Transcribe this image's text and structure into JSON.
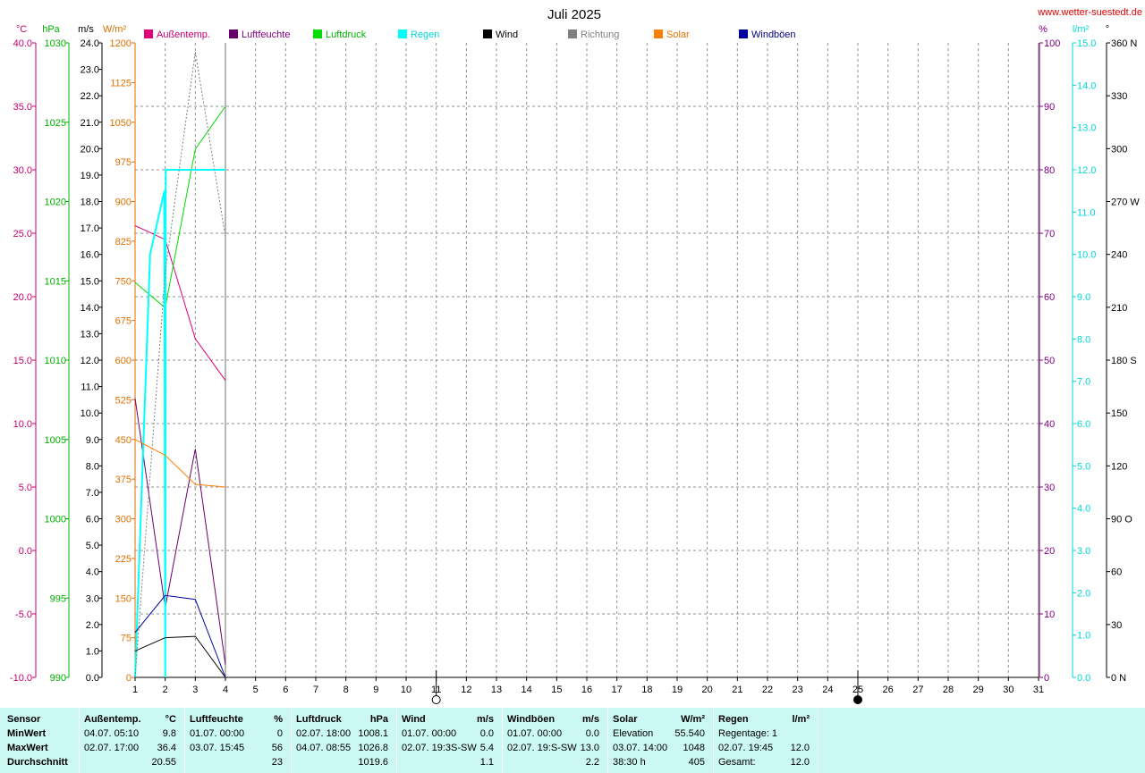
{
  "title": "Juli 2025",
  "site": "www.wetter-suestedt.de",
  "legend": [
    {
      "label": "Außentemp.",
      "color": "#e0007a",
      "text_color": "#c8006e"
    },
    {
      "label": "Luftfeuchte",
      "color": "#6a006a",
      "text_color": "#800080"
    },
    {
      "label": "Luftdruck",
      "color": "#00dd00",
      "text_color": "#00b000"
    },
    {
      "label": "Regen",
      "color": "#00ffff",
      "text_color": "#00d8d8"
    },
    {
      "label": "Wind",
      "color": "#000000",
      "text_color": "#000000"
    },
    {
      "label": "Richtung",
      "color": "#808080",
      "text_color": "#808080"
    },
    {
      "label": "Solar",
      "color": "#ff8000",
      "text_color": "#e07000"
    },
    {
      "label": "Windböen",
      "color": "#0000a0",
      "text_color": "#000080"
    }
  ],
  "chart_data": {
    "type": "line",
    "title": "Juli 2025",
    "x": [
      1,
      2,
      3,
      4
    ],
    "xlim": [
      1,
      31
    ],
    "xticks": [
      "1",
      "2",
      "3",
      "4",
      "5",
      "6",
      "7",
      "8",
      "9",
      "10",
      "11",
      "12",
      "13",
      "14",
      "15",
      "16",
      "17",
      "18",
      "19",
      "20",
      "21",
      "22",
      "23",
      "24",
      "25",
      "26",
      "27",
      "28",
      "29",
      "30",
      "31"
    ],
    "axes": {
      "temp": {
        "unit": "°C",
        "ticks": [
          "40.0",
          "35.0",
          "30.0",
          "25.0",
          "20.0",
          "15.0",
          "10.0",
          "5.0",
          "0.0",
          "-5.0",
          "-10.0"
        ],
        "range": [
          -10,
          40
        ],
        "color": "#c8006e"
      },
      "pressure": {
        "unit": "hPa",
        "ticks": [
          "1030",
          "1025",
          "1020",
          "1015",
          "1010",
          "1005",
          "1000",
          "995",
          "990"
        ],
        "range": [
          990,
          1030
        ],
        "color": "#00b000"
      },
      "wind": {
        "unit": "m/s",
        "ticks": [
          "24.0",
          "23.0",
          "22.0",
          "21.0",
          "20.0",
          "19.0",
          "18.0",
          "17.0",
          "16.0",
          "15.0",
          "14.0",
          "13.0",
          "12.0",
          "11.0",
          "10.0",
          "9.0",
          "8.0",
          "7.0",
          "6.0",
          "5.0",
          "4.0",
          "3.0",
          "2.0",
          "1.0",
          "0.0"
        ],
        "range": [
          0,
          24
        ],
        "color": "#000000"
      },
      "solar": {
        "unit": "W/m²",
        "ticks": [
          "1200",
          "1125",
          "1050",
          "975",
          "900",
          "825",
          "750",
          "675",
          "600",
          "525",
          "450",
          "375",
          "300",
          "225",
          "150",
          "75",
          "0"
        ],
        "range": [
          0,
          1200
        ],
        "color": "#e07000"
      },
      "humidity": {
        "unit": "%",
        "ticks": [
          "100",
          "90",
          "80",
          "70",
          "60",
          "50",
          "40",
          "30",
          "20",
          "10",
          "0"
        ],
        "range": [
          0,
          100
        ],
        "color": "#800080"
      },
      "rain": {
        "unit": "l/m²",
        "ticks": [
          "15.0",
          "14.0",
          "13.0",
          "12.0",
          "11.0",
          "10.0",
          "9.0",
          "8.0",
          "7.0",
          "6.0",
          "5.0",
          "4.0",
          "3.0",
          "2.0",
          "1.0",
          "0.0"
        ],
        "range": [
          0,
          15
        ],
        "color": "#00d8d8"
      },
      "direction": {
        "unit": "°",
        "ticks": [
          "360 N",
          "330",
          "300",
          "270 W",
          "240",
          "210",
          "180 S",
          "150",
          "120",
          "90 O",
          "60",
          "30",
          "0 N"
        ],
        "range": [
          0,
          360
        ],
        "color": "#000000"
      }
    },
    "series": [
      {
        "name": "Außentemp.",
        "axis": "temp",
        "x": [
          1,
          2,
          3,
          4
        ],
        "values": [
          25.6,
          24.5,
          16.7,
          13.4
        ],
        "color": "#e0007a"
      },
      {
        "name": "Luftfeuchte",
        "axis": "humidity",
        "x": [
          1,
          2,
          3,
          4
        ],
        "values": [
          44,
          11,
          36,
          2
        ],
        "color": "#6a006a"
      },
      {
        "name": "Luftdruck",
        "axis": "pressure",
        "x": [
          1,
          2,
          3,
          4
        ],
        "values": [
          1014.9,
          1013.3,
          1023.3,
          1026.0
        ],
        "color": "#00dd00"
      },
      {
        "name": "Regen",
        "axis": "rain",
        "x": [
          1,
          1.5,
          1.97,
          2,
          2.02,
          4
        ],
        "values": [
          0,
          10,
          11.5,
          0,
          12,
          12
        ],
        "color": "#00ffff"
      },
      {
        "name": "Wind",
        "axis": "wind",
        "x": [
          1,
          2,
          3,
          4
        ],
        "values": [
          1.0,
          1.5,
          1.55,
          0
        ],
        "color": "#000000"
      },
      {
        "name": "Richtung",
        "axis": "direction",
        "x": [
          1,
          2,
          3,
          4
        ],
        "values": [
          0,
          230,
          355,
          250
        ],
        "color": "#808080"
      },
      {
        "name": "Solar",
        "axis": "solar",
        "x": [
          1,
          2,
          3,
          4
        ],
        "values": [
          450,
          420,
          365,
          360
        ],
        "color": "#ff8000"
      },
      {
        "name": "Windböen",
        "axis": "wind",
        "x": [
          1,
          2,
          3,
          4
        ],
        "values": [
          1.7,
          3.1,
          2.95,
          0
        ],
        "color": "#0000a0"
      }
    ],
    "moon_marks": [
      {
        "x": 11,
        "phase": "full"
      },
      {
        "x": 25,
        "phase": "new"
      }
    ]
  },
  "stats": {
    "row_labels": [
      "Sensor",
      "MinWert",
      "MaxWert",
      "Durchschnitt"
    ],
    "columns": [
      {
        "name": "Außentemp.",
        "unit": "°C",
        "rows": [
          [
            "04.07.  05:10",
            "9.8"
          ],
          [
            "02.07.  17:00",
            "36.4"
          ],
          [
            "",
            "20.55"
          ]
        ]
      },
      {
        "name": "Luftfeuchte",
        "unit": "%",
        "rows": [
          [
            "01.07.  00:00",
            "0"
          ],
          [
            "03.07.  15:45",
            "56"
          ],
          [
            "",
            "23"
          ]
        ]
      },
      {
        "name": "Luftdruck",
        "unit": "hPa",
        "rows": [
          [
            "02.07.  18:00",
            "1008.1"
          ],
          [
            "04.07.  08:55",
            "1026.8"
          ],
          [
            "",
            "1019.6"
          ]
        ]
      },
      {
        "name": "Wind",
        "unit": "m/s",
        "rows": [
          [
            "01.07.  00:00",
            "0.0"
          ],
          [
            "02.07.  19:3S-SW",
            "5.4"
          ],
          [
            "",
            "1.1"
          ]
        ]
      },
      {
        "name": "Windböen",
        "unit": "m/s",
        "rows": [
          [
            "01.07.  00:00",
            "0.0"
          ],
          [
            "02.07.  19:S-SW",
            "13.0"
          ],
          [
            "",
            "2.2"
          ]
        ]
      },
      {
        "name": "Solar",
        "unit": "W/m²",
        "rows": [
          [
            "Elevation",
            "55.540"
          ],
          [
            "03.07.  14:00",
            "1048"
          ],
          [
            "38:30 h",
            "405"
          ]
        ]
      },
      {
        "name": "Regen",
        "unit": "l/m²",
        "rows": [
          [
            "Regentage: 1",
            ""
          ],
          [
            "02.07.  19:45",
            "12.0"
          ],
          [
            "Gesamt:",
            "12.0"
          ]
        ]
      }
    ]
  }
}
